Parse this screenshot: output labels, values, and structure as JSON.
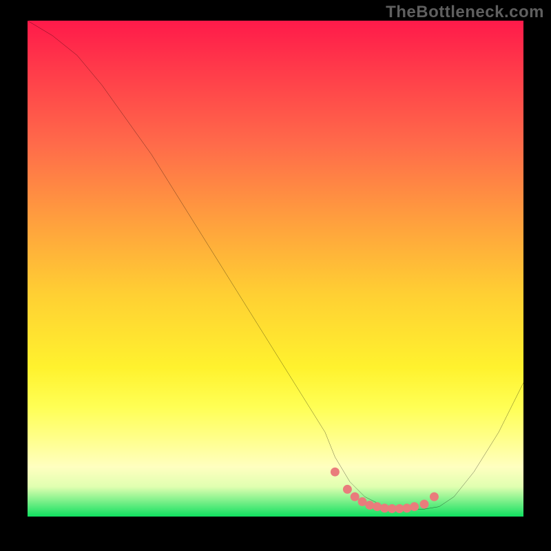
{
  "watermark": "TheBottleneck.com",
  "chart_data": {
    "type": "line",
    "title": "",
    "xlabel": "",
    "ylabel": "",
    "xlim": [
      0,
      100
    ],
    "ylim": [
      0,
      100
    ],
    "series": [
      {
        "name": "bottleneck-curve",
        "x": [
          0,
          5,
          10,
          15,
          20,
          25,
          30,
          35,
          40,
          45,
          50,
          55,
          60,
          62,
          65,
          68,
          72,
          76,
          80,
          83,
          86,
          90,
          95,
          100
        ],
        "y": [
          100,
          97,
          93,
          87,
          80,
          73,
          65,
          57,
          49,
          41,
          33,
          25,
          17,
          12,
          7,
          4,
          2,
          1.5,
          1.5,
          2,
          4,
          9,
          17,
          27
        ]
      }
    ],
    "markers": {
      "name": "optimal-zone-dots",
      "color": "#e97c7c",
      "x": [
        62,
        64.5,
        66,
        67.5,
        69,
        70.5,
        72,
        73.5,
        75,
        76.5,
        78,
        80,
        82
      ],
      "y": [
        9,
        5.5,
        4,
        3,
        2.3,
        2,
        1.7,
        1.6,
        1.6,
        1.7,
        2,
        2.5,
        4
      ]
    },
    "gradient_stops": [
      {
        "pos": 0,
        "color": "#ff1a4a"
      },
      {
        "pos": 25,
        "color": "#ff6b4a"
      },
      {
        "pos": 55,
        "color": "#ffcf33"
      },
      {
        "pos": 78,
        "color": "#ffff55"
      },
      {
        "pos": 100,
        "color": "#10e060"
      }
    ]
  }
}
